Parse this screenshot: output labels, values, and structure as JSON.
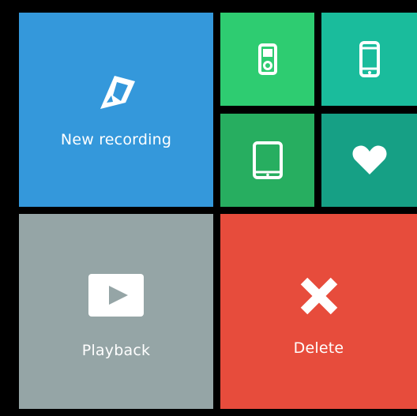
{
  "tiles": {
    "new_recording": {
      "label": "New recording",
      "icon": "pencil-icon",
      "color": "#3498db"
    },
    "ipod": {
      "icon": "ipod-icon",
      "color": "#2ecc71"
    },
    "phone": {
      "icon": "smartphone-icon",
      "color": "#1abc9c"
    },
    "tablet": {
      "icon": "tablet-icon",
      "color": "#27ae60"
    },
    "favorite": {
      "icon": "heart-icon",
      "color": "#16a085"
    },
    "playback": {
      "label": "Playback",
      "icon": "play-icon",
      "color": "#95a5a6"
    },
    "delete": {
      "label": "Delete",
      "icon": "x-icon",
      "color": "#e74c3c"
    }
  }
}
